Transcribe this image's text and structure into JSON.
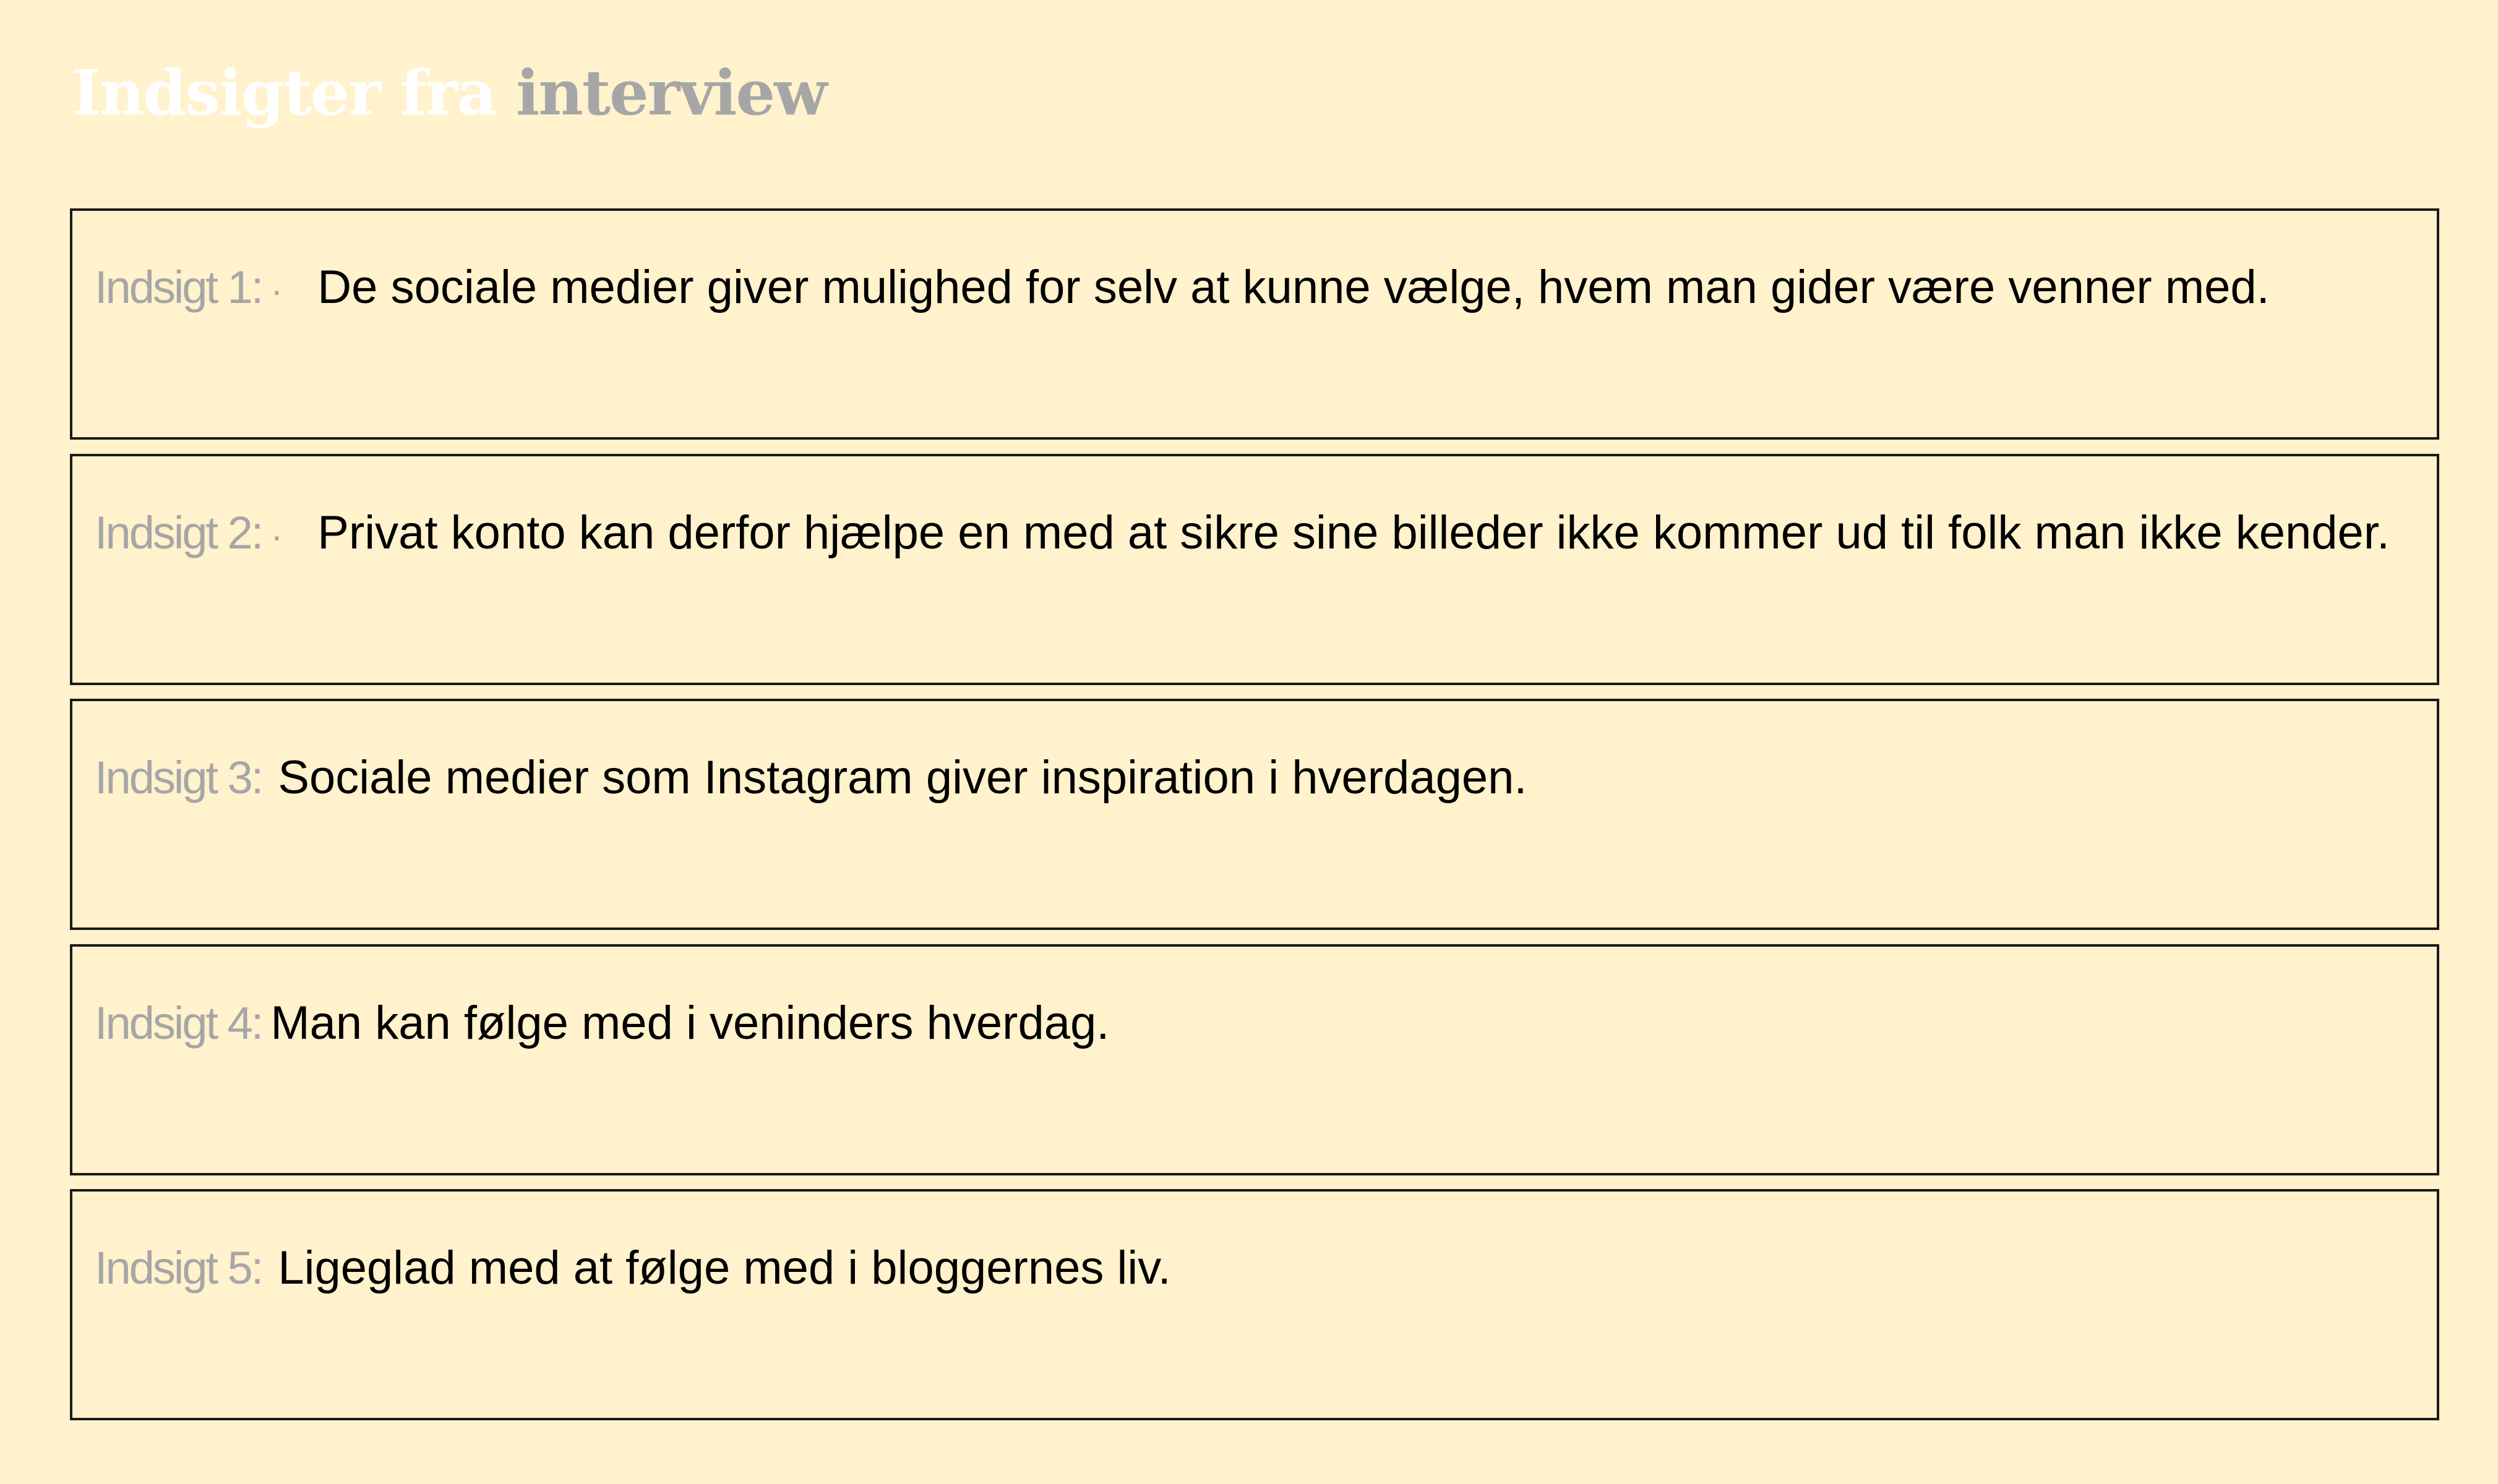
{
  "title": {
    "part1": "Indsigter fra ",
    "part2": "interview"
  },
  "insights": [
    {
      "label": "Indsigt 1:",
      "separator": "·",
      "text": "De sociale medier giver mulighed for selv at kunne vælge, hvem man gider være venner med."
    },
    {
      "label": "Indsigt 2:",
      "separator": "·",
      "text": "Privat konto kan derfor hjælpe en med at sikre sine billeder ikke kommer ud til folk man ikke kender."
    },
    {
      "label": "Indsigt 3:",
      "text": "Sociale medier som Instagram giver inspiration i hverdagen."
    },
    {
      "label": "Indsigt 4:",
      "text": "Man kan følge med i veninders hverdag."
    },
    {
      "label": "Indsigt 5:",
      "text": "Ligeglad med at følge med i bloggernes liv."
    }
  ],
  "colors": {
    "background": "#FFF2CC",
    "title_part1": "#FFFFFF",
    "title_part2": "#A6A6A6",
    "label": "#A6A6A6",
    "text": "#000000",
    "border": "#1a1a1a"
  }
}
